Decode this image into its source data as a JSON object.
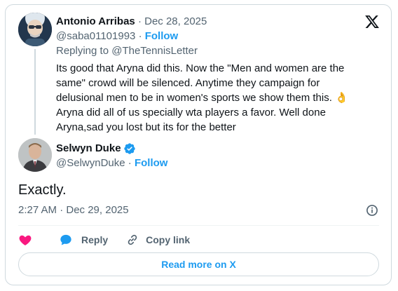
{
  "brand": {
    "logo_icon": "x-logo-icon",
    "accent": "#1d9bf0",
    "heart": "#f91880"
  },
  "reply_tweet": {
    "author_name": "Antonio Arribas",
    "date": "Dec 28, 2025",
    "handle": "@saba01101993",
    "follow_label": "Follow",
    "replying_to": "Replying to @TheTennisLetter",
    "text": "Its good that Aryna did this. Now the \"Men and women are the same\" crowd will be silenced. Anytime they campaign for delusional men to be in women's sports we show them this. 👌 Aryna did all of us specially wta players a favor. Well done Aryna,sad you lost but its for the better"
  },
  "main_tweet": {
    "author_name": "Selwyn Duke",
    "verified": true,
    "handle": "@SelwynDuke",
    "follow_label": "Follow",
    "text": "Exactly.",
    "timestamp": "2:27 AM · Dec 29, 2025"
  },
  "actions": {
    "like_icon": "heart-icon",
    "reply_label": "Reply",
    "copy_label": "Copy link"
  },
  "read_more_label": "Read more on X"
}
